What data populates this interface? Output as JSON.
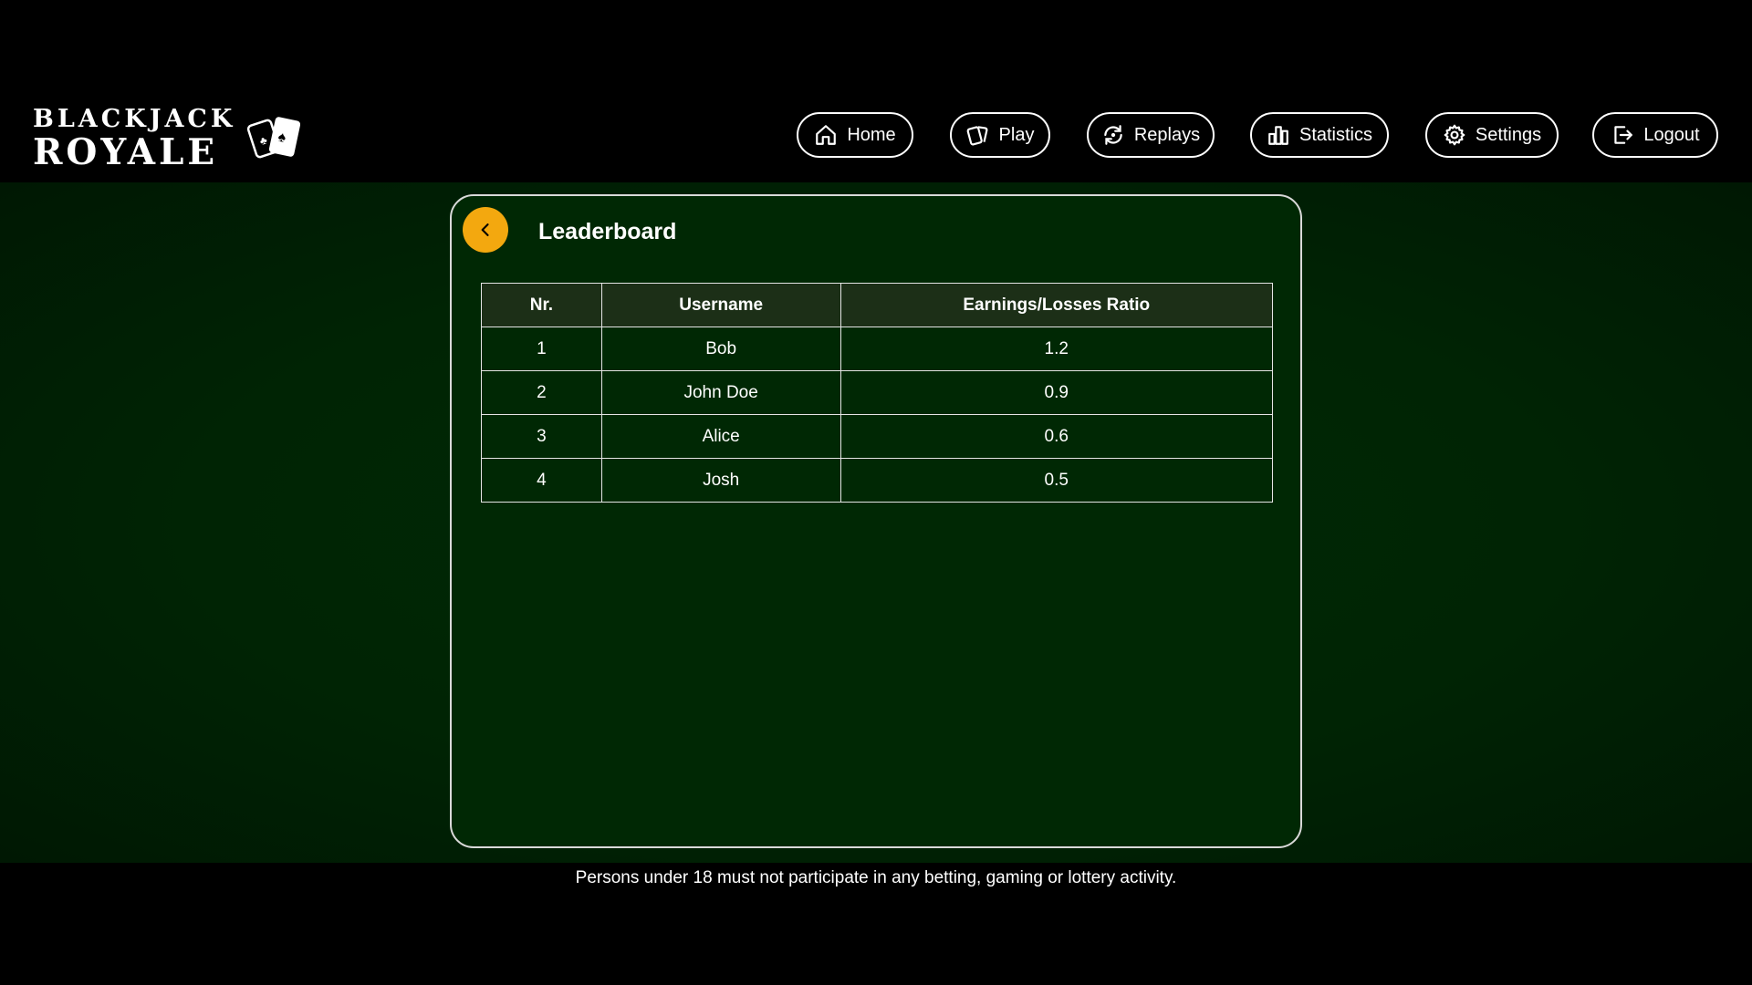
{
  "app": {
    "logo_line1": "BLACKJACK",
    "logo_line2": "ROYALE"
  },
  "nav": {
    "items": [
      {
        "label": "Home",
        "icon": "home-icon"
      },
      {
        "label": "Play",
        "icon": "cards-icon"
      },
      {
        "label": "Replays",
        "icon": "replay-icon"
      },
      {
        "label": "Statistics",
        "icon": "bar-chart-icon"
      },
      {
        "label": "Settings",
        "icon": "gear-icon"
      },
      {
        "label": "Logout",
        "icon": "logout-icon"
      }
    ]
  },
  "page": {
    "title": "Leaderboard",
    "back_icon": "chevron-left-icon",
    "accent_color": "#f3a80f"
  },
  "leaderboard": {
    "headers": [
      "Nr.",
      "Username",
      "Earnings/Losses Ratio"
    ],
    "rows": [
      [
        "1",
        "Bob",
        "1.2"
      ],
      [
        "2",
        "John Doe",
        "0.9"
      ],
      [
        "3",
        "Alice",
        "0.6"
      ],
      [
        "4",
        "Josh",
        "0.5"
      ]
    ]
  },
  "footer": {
    "disclaimer": "Persons under 18 must not participate in any betting, gaming or lottery activity."
  }
}
